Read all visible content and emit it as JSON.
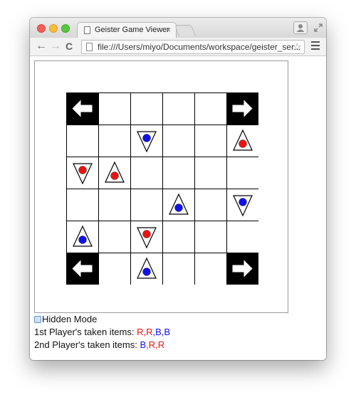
{
  "browser": {
    "tab_title": "Geister Game Viewer",
    "tab_close": "×",
    "url": "file:///Users/miyo/Documents/workspace/geister_ser...",
    "back": "←",
    "forward": "→",
    "reload": "C",
    "star": "☆"
  },
  "board": {
    "size": 6,
    "exits": [
      {
        "row": 0,
        "col": 0,
        "arrow": "left"
      },
      {
        "row": 0,
        "col": 5,
        "arrow": "right"
      },
      {
        "row": 5,
        "col": 0,
        "arrow": "left"
      },
      {
        "row": 5,
        "col": 5,
        "arrow": "right"
      }
    ],
    "pieces": [
      {
        "row": 1,
        "col": 2,
        "dir": "down",
        "color": "blue"
      },
      {
        "row": 1,
        "col": 5,
        "dir": "up",
        "color": "red"
      },
      {
        "row": 2,
        "col": 0,
        "dir": "down",
        "color": "red"
      },
      {
        "row": 2,
        "col": 1,
        "dir": "up",
        "color": "red"
      },
      {
        "row": 3,
        "col": 3,
        "dir": "up",
        "color": "blue"
      },
      {
        "row": 3,
        "col": 5,
        "dir": "down",
        "color": "blue"
      },
      {
        "row": 4,
        "col": 0,
        "dir": "up",
        "color": "blue"
      },
      {
        "row": 4,
        "col": 2,
        "dir": "down",
        "color": "red"
      },
      {
        "row": 5,
        "col": 2,
        "dir": "up",
        "color": "blue"
      }
    ]
  },
  "hidden_mode_label": "Hidden Mode",
  "player1_label": "1st Player's taken items: ",
  "player1_items": [
    "R",
    "R",
    "B",
    "B"
  ],
  "player2_label": "2nd Player's taken items: ",
  "player2_items": [
    "B",
    "R",
    "R"
  ],
  "colors": {
    "red": "#ee1111",
    "blue": "#1111ee",
    "exit_bg": "#000000"
  }
}
